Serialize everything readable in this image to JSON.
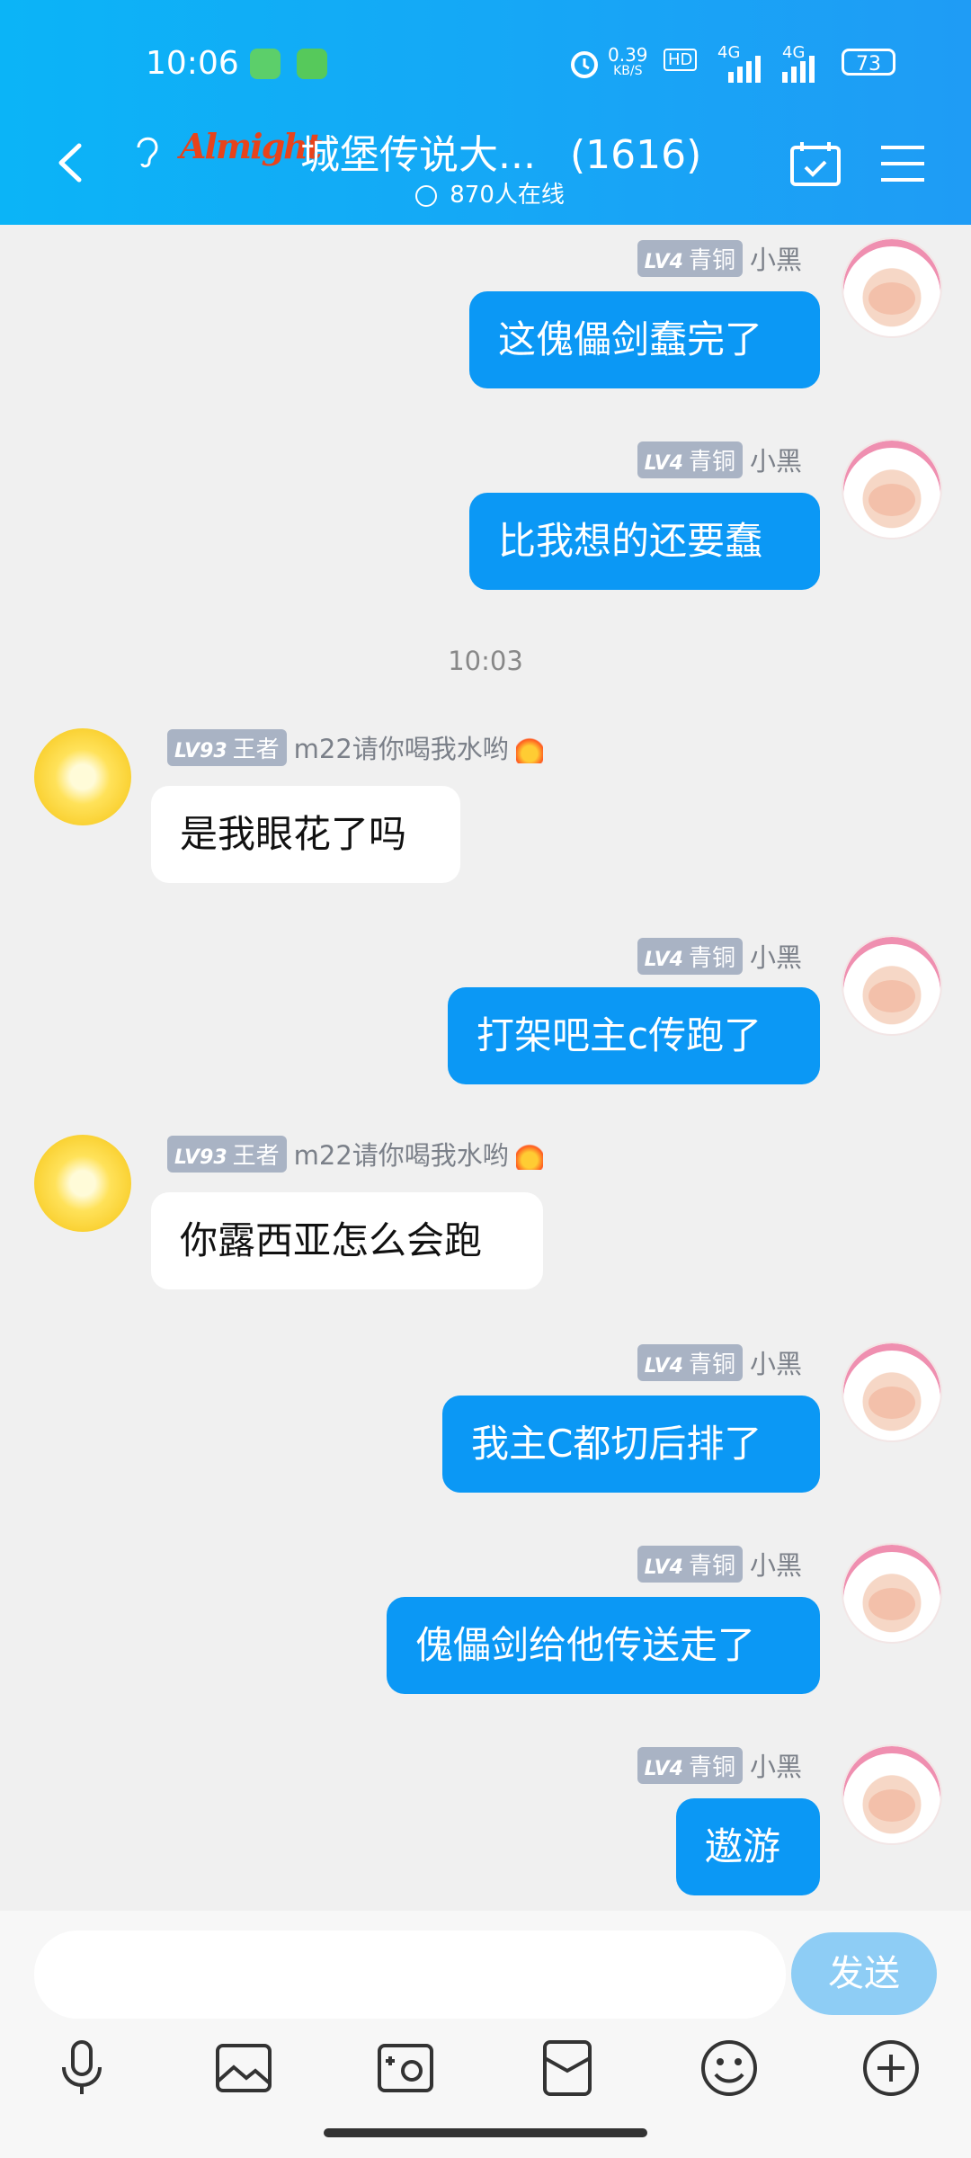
{
  "status_bar": {
    "time": "10:06",
    "net_speed_value": "0.39",
    "net_speed_unit": "KB/S",
    "hd_label": "HD",
    "signal1_label": "4G",
    "signal2_label": "4G",
    "battery": "73"
  },
  "header": {
    "logo_text": "Almight",
    "title": "城堡传说大...",
    "member_count": "(1616)",
    "online": "870人在线"
  },
  "messages": [
    {
      "side": "out",
      "level": "LV4",
      "rank": "青铜",
      "name": "小黑",
      "text": "这傀儡剑蠢完了"
    },
    {
      "side": "out",
      "level": "LV4",
      "rank": "青铜",
      "name": "小黑",
      "text": "比我想的还要蠢"
    },
    {
      "timestamp": "10:03"
    },
    {
      "side": "in",
      "level": "LV93",
      "rank": "王者",
      "name": "m22请你喝我水哟",
      "text": "是我眼花了吗"
    },
    {
      "side": "out",
      "level": "LV4",
      "rank": "青铜",
      "name": "小黑",
      "text": "打架吧主c传跑了"
    },
    {
      "side": "in",
      "level": "LV93",
      "rank": "王者",
      "name": "m22请你喝我水哟",
      "text": "你露西亚怎么会跑"
    },
    {
      "side": "out",
      "level": "LV4",
      "rank": "青铜",
      "name": "小黑",
      "text": "我主C都切后排了"
    },
    {
      "side": "out",
      "level": "LV4",
      "rank": "青铜",
      "name": "小黑",
      "text": "傀儡剑给他传送走了"
    },
    {
      "side": "out",
      "level": "LV4",
      "rank": "青铜",
      "name": "小黑",
      "text": "遨游"
    }
  ],
  "input": {
    "placeholder": "",
    "send_label": "发送"
  },
  "toolbar_icons": [
    "microphone-icon",
    "image-icon",
    "camera-icon",
    "red-packet-icon",
    "emoji-icon",
    "plus-icon"
  ]
}
